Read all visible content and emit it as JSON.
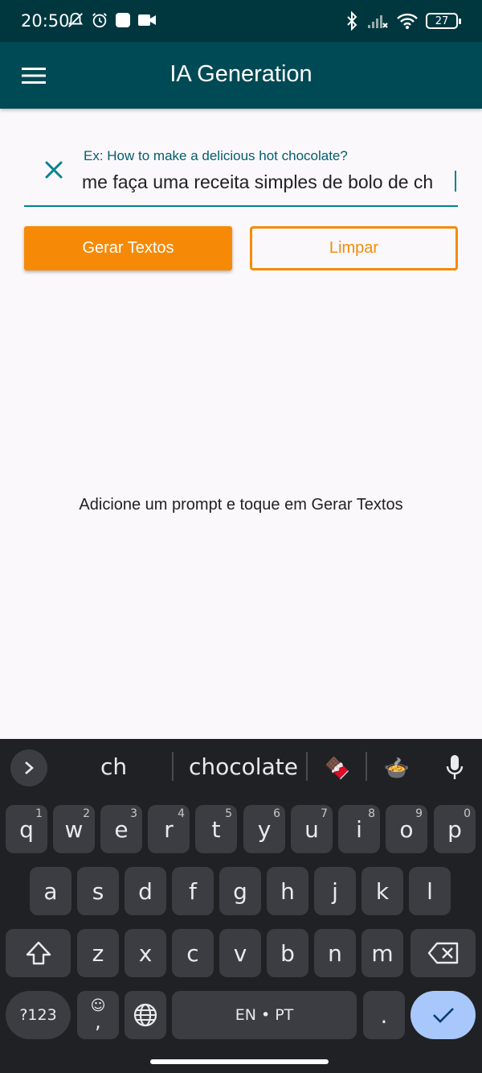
{
  "status_bar": {
    "time": "20:50",
    "battery": "27",
    "left_icons": [
      "notifications-off-icon",
      "alarm-icon",
      "square-app-icon",
      "video-camera-icon"
    ],
    "right_icons": [
      "bluetooth-icon",
      "signal-icon",
      "wifi-icon",
      "battery-icon"
    ]
  },
  "app_bar": {
    "title": "IA Generation"
  },
  "prompt": {
    "label": "Ex: How to make a delicious hot chocolate?",
    "value": "me faça uma receita simples de bolo de ch"
  },
  "buttons": {
    "generate": "Gerar Textos",
    "clear": "Limpar"
  },
  "empty_message": "Adicione um prompt e toque em Gerar Textos",
  "keyboard": {
    "suggestions": [
      "ch",
      "chocolate"
    ],
    "emoji_suggestions": [
      "🍫",
      "🍲"
    ],
    "row1": [
      {
        "k": "q",
        "h": "1"
      },
      {
        "k": "w",
        "h": "2"
      },
      {
        "k": "e",
        "h": "3"
      },
      {
        "k": "r",
        "h": "4"
      },
      {
        "k": "t",
        "h": "5"
      },
      {
        "k": "y",
        "h": "6"
      },
      {
        "k": "u",
        "h": "7"
      },
      {
        "k": "i",
        "h": "8"
      },
      {
        "k": "o",
        "h": "9"
      },
      {
        "k": "p",
        "h": "0"
      }
    ],
    "row2": [
      "a",
      "s",
      "d",
      "f",
      "g",
      "h",
      "j",
      "k",
      "l"
    ],
    "row3": [
      "z",
      "x",
      "c",
      "v",
      "b",
      "n",
      "m"
    ],
    "symbols_key": "?123",
    "emoji_comma_key": ",",
    "emoji_face": "☺",
    "space_key": "EN • PT",
    "period_key": "."
  },
  "colors": {
    "status_bar": "#00373f",
    "app_bar": "#004a55",
    "accent": "#f68a06",
    "teal": "#00838f",
    "keyboard_bg": "#202124",
    "key_bg": "#3c3d42",
    "enter_bg": "#a8c7fa"
  }
}
